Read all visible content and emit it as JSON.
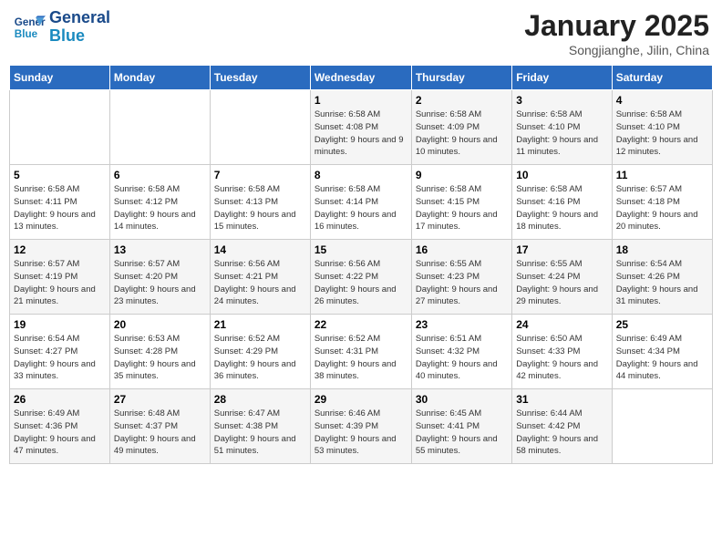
{
  "logo": {
    "line1": "General",
    "line2": "Blue"
  },
  "title": "January 2025",
  "subtitle": "Songjianghe, Jilin, China",
  "days_of_week": [
    "Sunday",
    "Monday",
    "Tuesday",
    "Wednesday",
    "Thursday",
    "Friday",
    "Saturday"
  ],
  "weeks": [
    [
      {
        "num": "",
        "sunrise": "",
        "sunset": "",
        "daylight": ""
      },
      {
        "num": "",
        "sunrise": "",
        "sunset": "",
        "daylight": ""
      },
      {
        "num": "",
        "sunrise": "",
        "sunset": "",
        "daylight": ""
      },
      {
        "num": "1",
        "sunrise": "Sunrise: 6:58 AM",
        "sunset": "Sunset: 4:08 PM",
        "daylight": "Daylight: 9 hours and 9 minutes."
      },
      {
        "num": "2",
        "sunrise": "Sunrise: 6:58 AM",
        "sunset": "Sunset: 4:09 PM",
        "daylight": "Daylight: 9 hours and 10 minutes."
      },
      {
        "num": "3",
        "sunrise": "Sunrise: 6:58 AM",
        "sunset": "Sunset: 4:10 PM",
        "daylight": "Daylight: 9 hours and 11 minutes."
      },
      {
        "num": "4",
        "sunrise": "Sunrise: 6:58 AM",
        "sunset": "Sunset: 4:10 PM",
        "daylight": "Daylight: 9 hours and 12 minutes."
      }
    ],
    [
      {
        "num": "5",
        "sunrise": "Sunrise: 6:58 AM",
        "sunset": "Sunset: 4:11 PM",
        "daylight": "Daylight: 9 hours and 13 minutes."
      },
      {
        "num": "6",
        "sunrise": "Sunrise: 6:58 AM",
        "sunset": "Sunset: 4:12 PM",
        "daylight": "Daylight: 9 hours and 14 minutes."
      },
      {
        "num": "7",
        "sunrise": "Sunrise: 6:58 AM",
        "sunset": "Sunset: 4:13 PM",
        "daylight": "Daylight: 9 hours and 15 minutes."
      },
      {
        "num": "8",
        "sunrise": "Sunrise: 6:58 AM",
        "sunset": "Sunset: 4:14 PM",
        "daylight": "Daylight: 9 hours and 16 minutes."
      },
      {
        "num": "9",
        "sunrise": "Sunrise: 6:58 AM",
        "sunset": "Sunset: 4:15 PM",
        "daylight": "Daylight: 9 hours and 17 minutes."
      },
      {
        "num": "10",
        "sunrise": "Sunrise: 6:58 AM",
        "sunset": "Sunset: 4:16 PM",
        "daylight": "Daylight: 9 hours and 18 minutes."
      },
      {
        "num": "11",
        "sunrise": "Sunrise: 6:57 AM",
        "sunset": "Sunset: 4:18 PM",
        "daylight": "Daylight: 9 hours and 20 minutes."
      }
    ],
    [
      {
        "num": "12",
        "sunrise": "Sunrise: 6:57 AM",
        "sunset": "Sunset: 4:19 PM",
        "daylight": "Daylight: 9 hours and 21 minutes."
      },
      {
        "num": "13",
        "sunrise": "Sunrise: 6:57 AM",
        "sunset": "Sunset: 4:20 PM",
        "daylight": "Daylight: 9 hours and 23 minutes."
      },
      {
        "num": "14",
        "sunrise": "Sunrise: 6:56 AM",
        "sunset": "Sunset: 4:21 PM",
        "daylight": "Daylight: 9 hours and 24 minutes."
      },
      {
        "num": "15",
        "sunrise": "Sunrise: 6:56 AM",
        "sunset": "Sunset: 4:22 PM",
        "daylight": "Daylight: 9 hours and 26 minutes."
      },
      {
        "num": "16",
        "sunrise": "Sunrise: 6:55 AM",
        "sunset": "Sunset: 4:23 PM",
        "daylight": "Daylight: 9 hours and 27 minutes."
      },
      {
        "num": "17",
        "sunrise": "Sunrise: 6:55 AM",
        "sunset": "Sunset: 4:24 PM",
        "daylight": "Daylight: 9 hours and 29 minutes."
      },
      {
        "num": "18",
        "sunrise": "Sunrise: 6:54 AM",
        "sunset": "Sunset: 4:26 PM",
        "daylight": "Daylight: 9 hours and 31 minutes."
      }
    ],
    [
      {
        "num": "19",
        "sunrise": "Sunrise: 6:54 AM",
        "sunset": "Sunset: 4:27 PM",
        "daylight": "Daylight: 9 hours and 33 minutes."
      },
      {
        "num": "20",
        "sunrise": "Sunrise: 6:53 AM",
        "sunset": "Sunset: 4:28 PM",
        "daylight": "Daylight: 9 hours and 35 minutes."
      },
      {
        "num": "21",
        "sunrise": "Sunrise: 6:52 AM",
        "sunset": "Sunset: 4:29 PM",
        "daylight": "Daylight: 9 hours and 36 minutes."
      },
      {
        "num": "22",
        "sunrise": "Sunrise: 6:52 AM",
        "sunset": "Sunset: 4:31 PM",
        "daylight": "Daylight: 9 hours and 38 minutes."
      },
      {
        "num": "23",
        "sunrise": "Sunrise: 6:51 AM",
        "sunset": "Sunset: 4:32 PM",
        "daylight": "Daylight: 9 hours and 40 minutes."
      },
      {
        "num": "24",
        "sunrise": "Sunrise: 6:50 AM",
        "sunset": "Sunset: 4:33 PM",
        "daylight": "Daylight: 9 hours and 42 minutes."
      },
      {
        "num": "25",
        "sunrise": "Sunrise: 6:49 AM",
        "sunset": "Sunset: 4:34 PM",
        "daylight": "Daylight: 9 hours and 44 minutes."
      }
    ],
    [
      {
        "num": "26",
        "sunrise": "Sunrise: 6:49 AM",
        "sunset": "Sunset: 4:36 PM",
        "daylight": "Daylight: 9 hours and 47 minutes."
      },
      {
        "num": "27",
        "sunrise": "Sunrise: 6:48 AM",
        "sunset": "Sunset: 4:37 PM",
        "daylight": "Daylight: 9 hours and 49 minutes."
      },
      {
        "num": "28",
        "sunrise": "Sunrise: 6:47 AM",
        "sunset": "Sunset: 4:38 PM",
        "daylight": "Daylight: 9 hours and 51 minutes."
      },
      {
        "num": "29",
        "sunrise": "Sunrise: 6:46 AM",
        "sunset": "Sunset: 4:39 PM",
        "daylight": "Daylight: 9 hours and 53 minutes."
      },
      {
        "num": "30",
        "sunrise": "Sunrise: 6:45 AM",
        "sunset": "Sunset: 4:41 PM",
        "daylight": "Daylight: 9 hours and 55 minutes."
      },
      {
        "num": "31",
        "sunrise": "Sunrise: 6:44 AM",
        "sunset": "Sunset: 4:42 PM",
        "daylight": "Daylight: 9 hours and 58 minutes."
      },
      {
        "num": "",
        "sunrise": "",
        "sunset": "",
        "daylight": ""
      }
    ]
  ]
}
